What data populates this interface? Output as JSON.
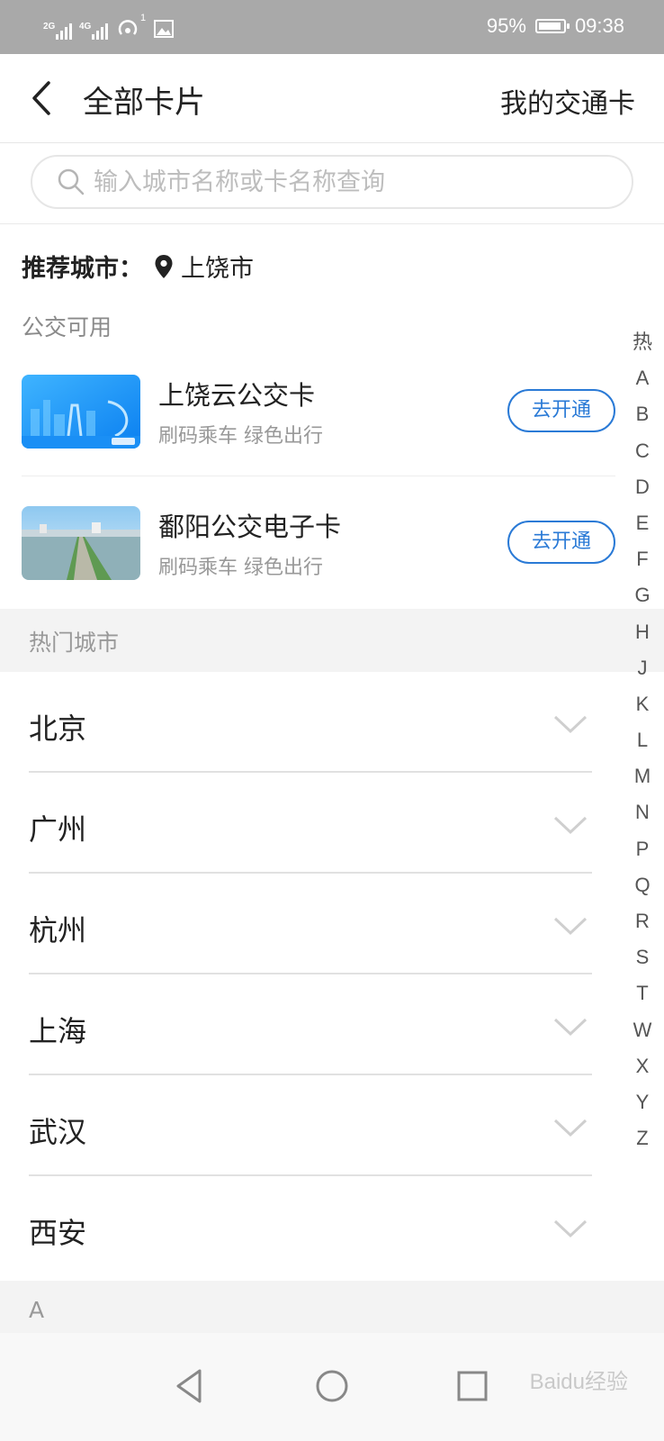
{
  "status_bar": {
    "signal1_tag": "2G",
    "signal2_tag": "4G",
    "hotspot_badge": "1",
    "battery_percent": "95%",
    "battery_level": 0.95,
    "time": "09:38"
  },
  "header": {
    "title": "全部卡片",
    "right_action": "我的交通卡"
  },
  "search": {
    "placeholder": "输入城市名称或卡名称查询",
    "value": ""
  },
  "recommend": {
    "label": "推荐城市：",
    "city": "上饶市",
    "caption": "公交可用",
    "cards": [
      {
        "name": "上饶云公交卡",
        "subtitle": "刷码乘车 绿色出行",
        "button": "去开通"
      },
      {
        "name": "鄱阳公交电子卡",
        "subtitle": "刷码乘车 绿色出行",
        "button": "去开通"
      }
    ]
  },
  "hot_cities": {
    "header": "热门城市",
    "cities": [
      "北京",
      "广州",
      "杭州",
      "上海",
      "武汉",
      "西安"
    ]
  },
  "section_a": {
    "header": "A"
  },
  "index_bar": [
    "热",
    "A",
    "B",
    "C",
    "D",
    "E",
    "F",
    "G",
    "H",
    "J",
    "K",
    "L",
    "M",
    "N",
    "P",
    "Q",
    "R",
    "S",
    "T",
    "W",
    "X",
    "Y",
    "Z"
  ],
  "watermark": "Baidu经验",
  "colors": {
    "accent": "#2a7ad6",
    "status_bar": "#a9a9a9",
    "section_bg": "#f3f3f3"
  }
}
